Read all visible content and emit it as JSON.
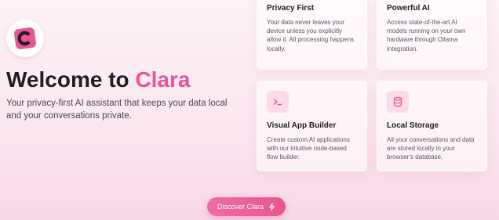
{
  "brand": {
    "logo_icon": "clara-logo-icon",
    "accent_color": "#e8558f"
  },
  "hero": {
    "title_prefix": "Welcome to ",
    "title_brand": "Clara",
    "subtitle": "Your privacy-first AI assistant that keeps your data local and your conversations private."
  },
  "features": [
    {
      "title": "Privacy First",
      "description": "Your data never leaves your device unless you explicitly allow it. All processing happens locally."
    },
    {
      "title": "Powerful AI",
      "description": "Access state-of-the-art AI models running on your own hardware through Ollama integration."
    },
    {
      "icon": "terminal-icon",
      "title": "Visual App Builder",
      "description": "Create custom AI applications with our intuitive node-based flow builder."
    },
    {
      "icon": "database-icon",
      "title": "Local Storage",
      "description": "All your conversations and data are stored locally in your browser's database."
    }
  ],
  "cta": {
    "label": "Discover Clara",
    "icon": "lightning-icon"
  }
}
